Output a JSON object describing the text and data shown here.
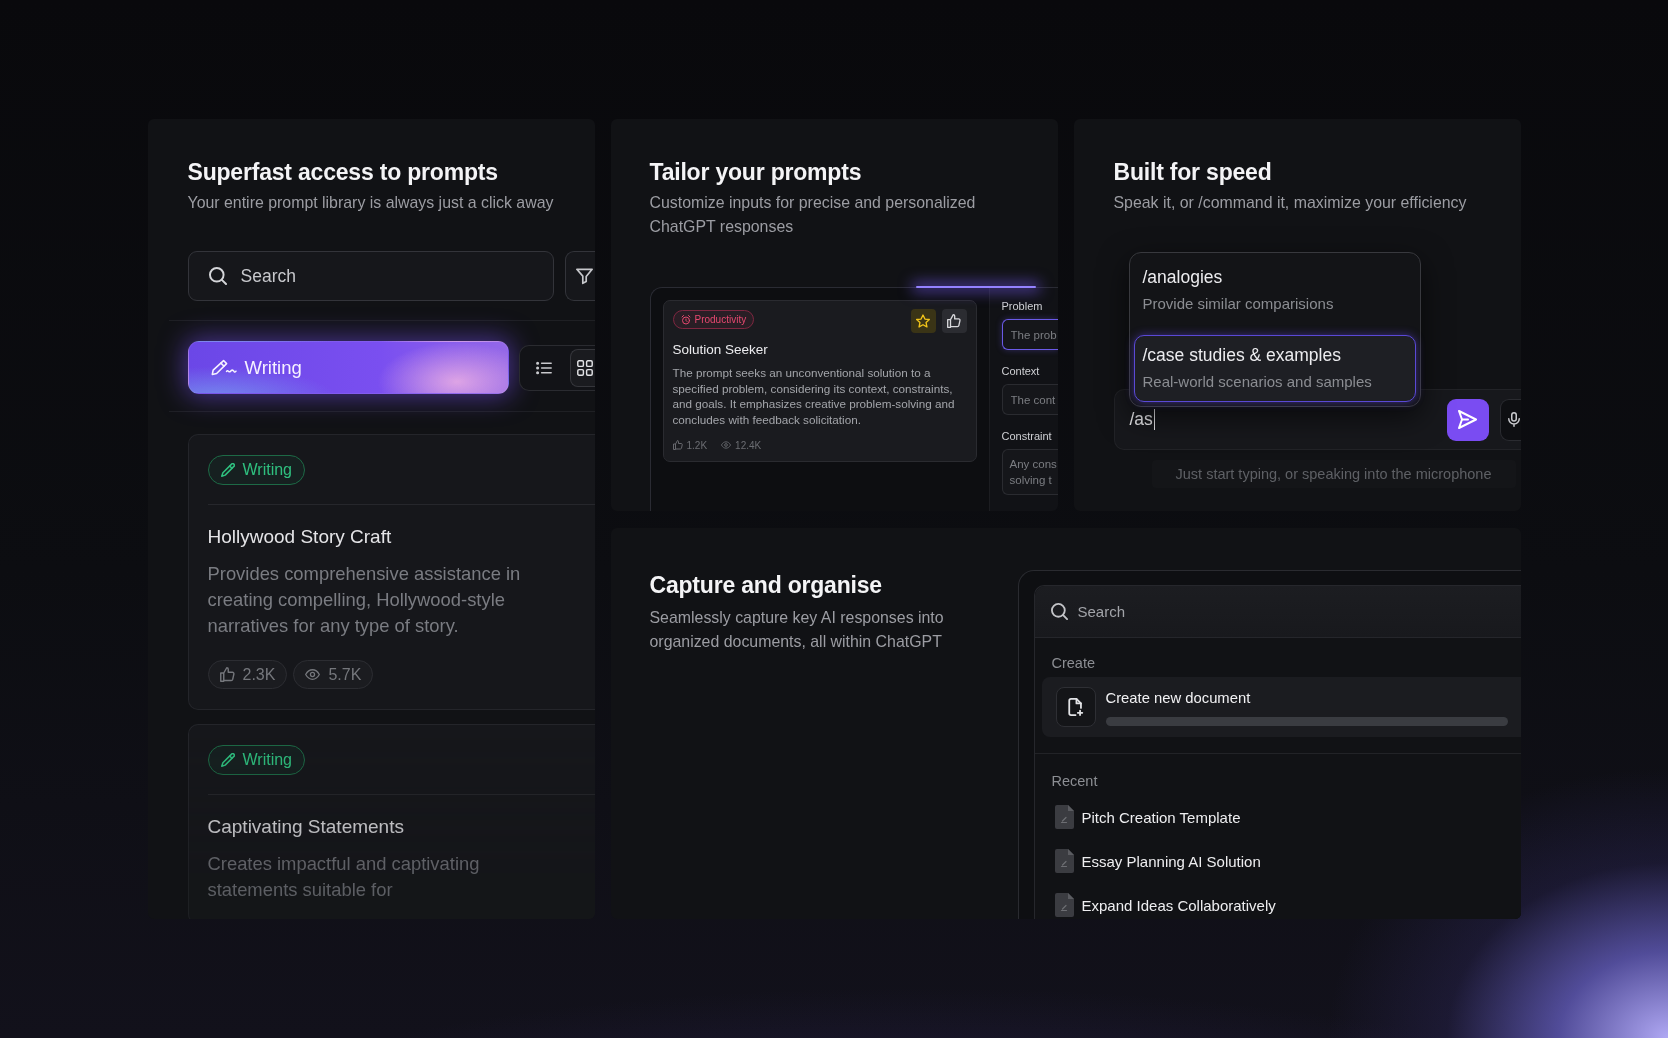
{
  "library": {
    "title": "Superfast access to prompts",
    "subtitle": "Your entire prompt library is always just a click away",
    "search": {
      "placeholder": "Search"
    },
    "category": {
      "label": "Writing",
      "selected": true
    },
    "views": [
      {
        "kind": "list",
        "selected": false
      },
      {
        "kind": "grid",
        "selected": true
      }
    ],
    "cards": [
      {
        "tag": "Writing",
        "title": "Hollywood Story Craft",
        "description": "Provides comprehensive assistance in creating compelling, Hollywood-style narratives for any type of story.",
        "likes": "2.3K",
        "views": "5.7K"
      },
      {
        "tag": "Writing",
        "title": "Captivating Statements",
        "description": "Creates impactful and captivating statements suitable for"
      }
    ]
  },
  "tailor": {
    "title": "Tailor your prompts",
    "subtitle": "Customize inputs for precise and personalized ChatGPT responses",
    "prompt": {
      "tag": "Productivity",
      "title": "Solution Seeker",
      "description": "The prompt seeks an unconventional solution to a specified problem, considering its context, constraints, and goals. It emphasizes creative problem-solving and concludes with feedback solicitation.",
      "likes": "1.2K",
      "views": "12.4K",
      "favorite": true,
      "liked": false
    },
    "fields": [
      {
        "kind": "input",
        "label": "Problem",
        "placeholder": "The prob",
        "focused": true
      },
      {
        "kind": "input",
        "label": "Context",
        "placeholder": "The cont",
        "focused": false
      },
      {
        "kind": "textarea",
        "label": "Constraint",
        "placeholder": "Any cons solving t",
        "focused": false
      }
    ]
  },
  "speed": {
    "title": "Built for speed",
    "subtitle": "Speak it, or /command it, maximize your efficiency",
    "suggestions": [
      {
        "command": "/analogies",
        "description": "Provide similar comparisions",
        "selected": false
      },
      {
        "command": "/case studies & examples",
        "description": "Real-world scenarios and samples",
        "selected": true
      }
    ],
    "input": {
      "value": "/as"
    },
    "hint": "Just start typing, or speaking into the microphone"
  },
  "capture": {
    "title": "Capture and organise",
    "subtitle": "Seamlessly capture key AI responses into organized documents, all within ChatGPT",
    "search": {
      "placeholder": "Search"
    },
    "create_heading": "Create",
    "create_item": "Create new document",
    "recent_heading": "Recent",
    "recent": [
      "Pitch Creation Template",
      "Essay Planning AI Solution",
      "Expand Ideas Collaboratively"
    ]
  }
}
